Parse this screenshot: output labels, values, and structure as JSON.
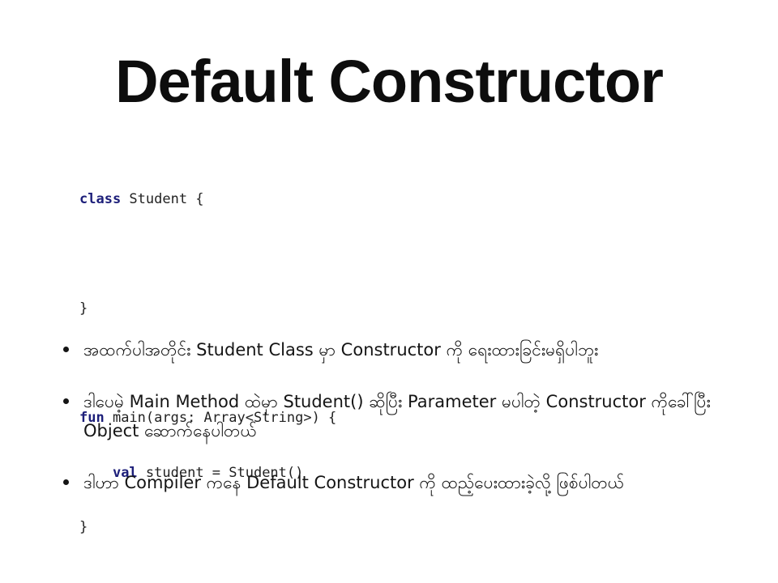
{
  "slide": {
    "title": "Default Constructor"
  },
  "code": {
    "lines": [
      [
        {
          "t": "class",
          "kw": true
        },
        {
          "t": " Student {",
          "kw": false
        }
      ],
      [],
      [
        {
          "t": "}",
          "kw": false
        }
      ],
      [],
      [
        {
          "t": "fun",
          "kw": true
        },
        {
          "t": " main(args: Array<String>) {",
          "kw": false
        }
      ],
      [
        {
          "t": "    ",
          "kw": false
        },
        {
          "t": "val",
          "kw": true
        },
        {
          "t": " student = Student()",
          "kw": false
        }
      ],
      [
        {
          "t": "}",
          "kw": false
        }
      ]
    ]
  },
  "bullets": [
    "အထက်ပါအတိုင်း Student Class မှာ Constructor ကို ရေးထားခြင်းမရှိပါဘူး",
    "ဒါပေမဲ့ Main Method ထဲမှာ Student() ဆိုပြီး Parameter မပါတဲ့ Constructor ကိုခေါ်ပြီး Object ဆောက်နေပါတယ်",
    "ဒါဟာ Compiler ကနေ Default Constructor ကို ထည့်ပေးထားခဲ့လို့ ဖြစ်ပါတယ်"
  ]
}
